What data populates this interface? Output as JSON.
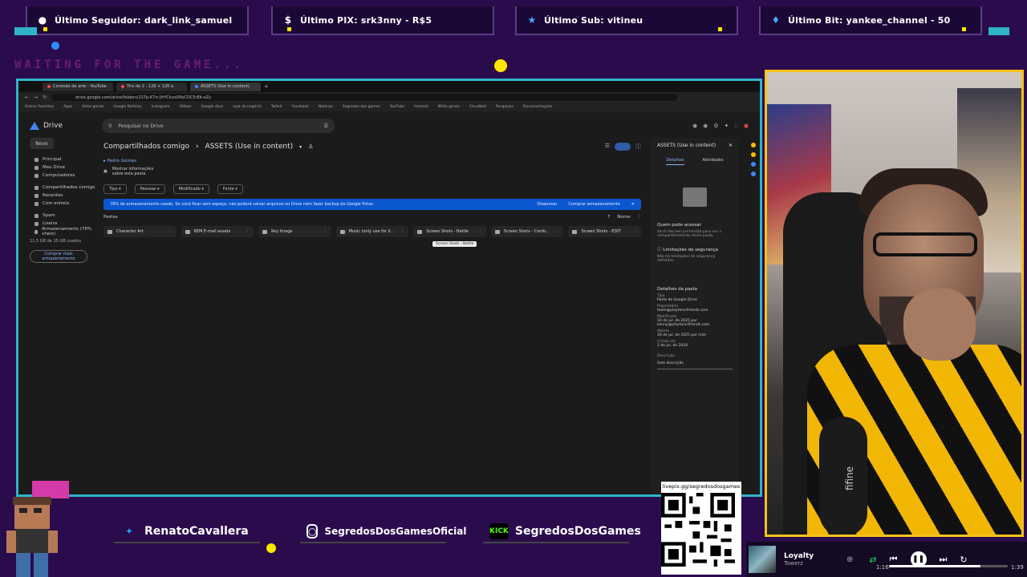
{
  "overlay": {
    "alerts": [
      {
        "label": "Último Seguidor: dark_link_samuel",
        "icon": "user-icon",
        "color": "#ffffff"
      },
      {
        "label": "Último PIX: srk3nny - R$5",
        "icon": "dollar-icon",
        "color": "#ffffff"
      },
      {
        "label": "Último Sub: vitineu",
        "icon": "star-icon",
        "color": "#ffffff"
      },
      {
        "label": "Último Bit: yankee_channel - 50",
        "icon": "diamond-icon",
        "color": "#ffffff"
      }
    ],
    "waiting_text": "WAITING FOR THE GAME...",
    "accent_cyan": "#2fb3c9",
    "accent_yellow": "#f6c21a",
    "background": "#2a0c4d"
  },
  "browser": {
    "tabs": [
      "Conexão de arte - YouTube",
      "Tiro de 2 - 126 × 126 e.",
      "ASSETS (Use in content)"
    ],
    "address": "drive.google.com/drive/folders/1S7p-K7rr-JfrYCkvoUPpCDC5rEb-eZy",
    "bookmarks": [
      "Outros favoritos",
      "Apps",
      "Artes gerais",
      "Google Notícias",
      "Instagram",
      "Vídeos",
      "Google docs",
      "Loja do negócio",
      "Twitch",
      "Facebook",
      "Notícias",
      "Segredos dos games",
      "YouTube",
      "Hotmail",
      "Mídia gerais",
      "Cloudbell",
      "Pesquisas",
      "Documentações"
    ]
  },
  "drive": {
    "brand": "Drive",
    "search_placeholder": "Pesquisar no Drive",
    "new_label": "Novo",
    "sidebar": [
      {
        "label": "Principal",
        "icon": "home-icon"
      },
      {
        "label": "Meu Drive",
        "icon": "drive-icon"
      },
      {
        "label": "Computadores",
        "icon": "computer-icon"
      },
      {
        "label": "Compartilhados comigo",
        "icon": "people-icon"
      },
      {
        "label": "Recentes",
        "icon": "clock-icon"
      },
      {
        "label": "Com estrela",
        "icon": "star-icon"
      },
      {
        "label": "Spam",
        "icon": "spam-icon"
      },
      {
        "label": "Lixeira",
        "icon": "trash-icon"
      },
      {
        "label": "Armazenamento (78% cheio)",
        "icon": "cloud-icon"
      }
    ],
    "storage_text": "11,5 GB de 15 GB usados",
    "storage_button": "Comprar mais armazenamento",
    "breadcrumb": {
      "root": "Compartilhados comigo",
      "current": "ASSETS (Use in content)"
    },
    "owner_note": "Pedro Gomes",
    "info_card": "Mostrar informações sobre esta pasta",
    "filters": [
      "Tipo",
      "Pessoas",
      "Modificado",
      "Fonte"
    ],
    "banner": {
      "text": "78% do armazenamento usado. Se você ficar sem espaço, não poderá salvar arquivos no Drive nem fazer backup de Google Fotos.",
      "dismiss": "Dispensar",
      "action": "Comprar armazenamento"
    },
    "section_label": "Pastas",
    "sort_label": "Nome",
    "folders": [
      "Character Art",
      "KEM E-mail assets",
      "Key Image",
      "Music (only use for li...",
      "Screen Shots - Battle",
      "Screen Shots - Comb...",
      "Screen Shots - EDIT"
    ],
    "tooltip": "Screen Shots - Battle",
    "details": {
      "title": "ASSETS (Use in content)",
      "tab_details": "Detalhes",
      "tab_activity": "Atividades",
      "access_heading": "Quem pode acessar",
      "access_text": "Você não tem permissão para ver o compartilhamento desta pasta.",
      "security_heading": "Limitações de segurança",
      "security_text": "Não há limitações de segurança definidas.",
      "folder_heading": "Detalhes da pasta",
      "type_label": "Tipo",
      "type_value": "Pasta do Google Drive",
      "owner_label": "Proprietário",
      "owner_value": "team@playtonicfriends.com",
      "modified_label": "Modificado",
      "modified_value": "16 de jul. de 2025 por",
      "modified_by": "kenny@playtonicfriends.com",
      "opened_label": "Aberto",
      "opened_value": "16 de jul. de 2025 por mim",
      "created_label": "Criado em",
      "created_value": "2 de jul. de 2024",
      "desc_label": "Descrição",
      "desc_placeholder": "Sem descrição"
    }
  },
  "social": [
    {
      "handle": "RenatoCavallera",
      "icon": "twitter-icon"
    },
    {
      "handle": "SegredosDosGamesOficial",
      "icon": "instagram-icon"
    },
    {
      "handle": "SegredosDosGames",
      "icon": "kick-icon",
      "badge": "KICK"
    }
  ],
  "qr": {
    "url": "livepix.gg/segredosdosgames"
  },
  "player": {
    "title": "Loyalty",
    "artist": "Towerz",
    "elapsed": "1:16",
    "duration": "1:39",
    "progress": 0.77
  },
  "cam": {
    "mic_brand": "fifine"
  }
}
